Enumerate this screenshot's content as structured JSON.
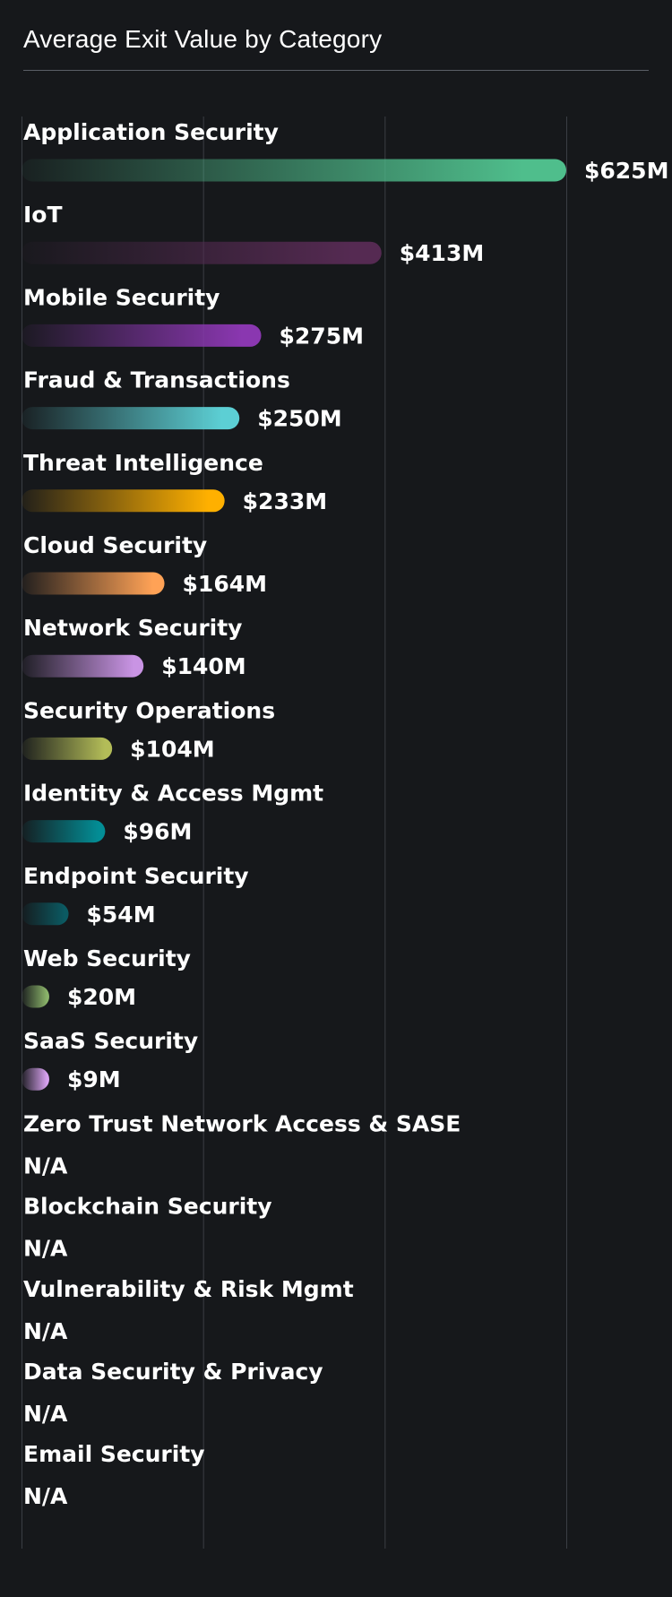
{
  "header": {
    "title": "Average Exit Value by Category"
  },
  "chart_data": {
    "type": "bar",
    "orientation": "horizontal",
    "title": "Average Exit Value by Category",
    "xlabel": "",
    "ylabel": "",
    "unit_prefix": "$",
    "unit_suffix": "M",
    "xlim": [
      0,
      625
    ],
    "grid": true,
    "missing_label": "N/A",
    "categories": [
      "Application Security",
      "IoT",
      "Mobile Security",
      "Fraud & Transactions",
      "Threat Intelligence",
      "Cloud Security",
      "Network Security",
      "Security Operations",
      "Identity & Access Mgmt",
      "Endpoint Security",
      "Web Security",
      "SaaS Security",
      "Zero Trust Network Access & SASE",
      "Blockchain Security",
      "Vulnerability & Risk Mgmt",
      "Data Security & Privacy",
      "Email Security"
    ],
    "values": [
      625,
      413,
      275,
      250,
      233,
      164,
      140,
      104,
      96,
      54,
      20,
      9,
      null,
      null,
      null,
      null,
      null
    ],
    "value_labels": [
      "$625M",
      "$413M",
      "$275M",
      "$250M",
      "$233M",
      "$164M",
      "$140M",
      "$104M",
      "$96M",
      "$54M",
      "$20M",
      "$9M",
      "N/A",
      "N/A",
      "N/A",
      "N/A",
      "N/A"
    ],
    "colors": [
      "#4fbe8c",
      "#552a52",
      "#8a37b0",
      "#5ccfd4",
      "#ffb000",
      "#ffa256",
      "#c994e4",
      "#b3bc58",
      "#038d95",
      "#0b5a62",
      "#8bb46a",
      "#d8a2f0",
      "#ffffff",
      "#ffffff",
      "#ffffff",
      "#ffffff",
      "#ffffff"
    ]
  }
}
